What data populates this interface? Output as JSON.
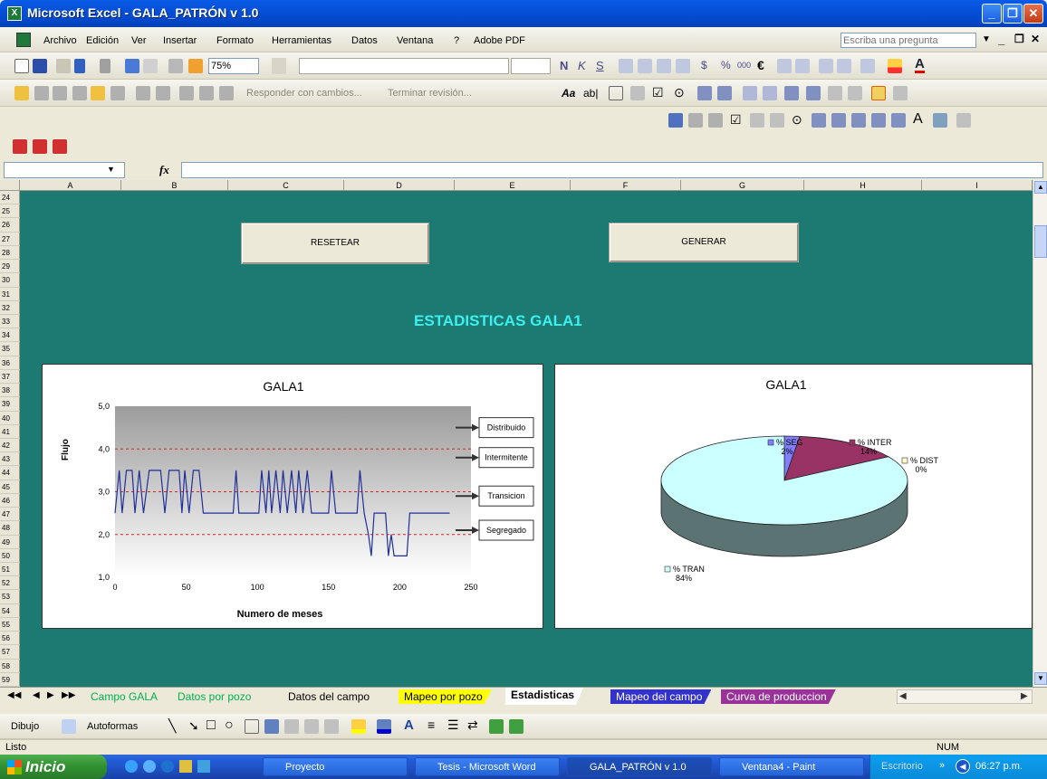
{
  "window": {
    "title": "Microsoft Excel - GALA_PATRÓN v 1.0"
  },
  "menu": {
    "items": [
      "Archivo",
      "Edición",
      "Ver",
      "Insertar",
      "Formato",
      "Herramientas",
      "Datos",
      "Ventana",
      "?",
      "Adobe PDF"
    ],
    "ask_placeholder": "Escriba una pregunta"
  },
  "toolbar": {
    "zoom": "75%",
    "review_reply": "Responder con cambios...",
    "review_end": "Terminar revisión..."
  },
  "formula_bar": {
    "fx": "fx",
    "name_box": "",
    "content": ""
  },
  "columns": [
    "A",
    "B",
    "C",
    "D",
    "E",
    "F",
    "G",
    "H",
    "I"
  ],
  "rows": [
    "24",
    "25",
    "26",
    "27",
    "28",
    "29",
    "30",
    "31",
    "32",
    "33",
    "34",
    "35",
    "36",
    "37",
    "38",
    "39",
    "40",
    "41",
    "42",
    "43",
    "44",
    "45",
    "46",
    "47",
    "48",
    "49",
    "50",
    "51",
    "52",
    "53",
    "54",
    "55",
    "56",
    "57",
    "58",
    "59"
  ],
  "sheet": {
    "reset_label": "RESETEAR",
    "generate_label": "GENERAR",
    "stats_title": "ESTADISTICAS GALA1"
  },
  "chart_data": [
    {
      "type": "line",
      "title": "GALA1",
      "xlabel": "Numero de meses",
      "ylabel": "Flujo",
      "xlim": [
        0,
        250
      ],
      "ylim": [
        1.0,
        5.0
      ],
      "xticks": [
        "0",
        "50",
        "100",
        "150",
        "200",
        "250"
      ],
      "yticks": [
        "1,0",
        "2,0",
        "3,0",
        "4,0",
        "5,0"
      ],
      "series": [
        {
          "values": [
            [
              0,
              2.5
            ],
            [
              3,
              3.5
            ],
            [
              5,
              2.5
            ],
            [
              8,
              3.5
            ],
            [
              12,
              3.5
            ],
            [
              14,
              2.5
            ],
            [
              17,
              3.5
            ],
            [
              20,
              2.5
            ],
            [
              24,
              3.5
            ],
            [
              32,
              3.5
            ],
            [
              35,
              2.5
            ],
            [
              38,
              3.5
            ],
            [
              45,
              3.5
            ],
            [
              47,
              2.5
            ],
            [
              49,
              3.5
            ],
            [
              52,
              2.5
            ],
            [
              55,
              3.5
            ],
            [
              59,
              3.5
            ],
            [
              62,
              2.5
            ],
            [
              83,
              2.5
            ],
            [
              85,
              3.5
            ],
            [
              87,
              2.5
            ],
            [
              101,
              2.5
            ],
            [
              103,
              3.5
            ],
            [
              106,
              2.5
            ],
            [
              108,
              3.5
            ],
            [
              110,
              2.5
            ],
            [
              113,
              3.5
            ],
            [
              116,
              2.5
            ],
            [
              118,
              3.5
            ],
            [
              121,
              2.5
            ],
            [
              124,
              3.5
            ],
            [
              127,
              2.5
            ],
            [
              129,
              3.5
            ],
            [
              132,
              2.5
            ],
            [
              135,
              3.5
            ],
            [
              138,
              2.5
            ],
            [
              150,
              2.5
            ],
            [
              152,
              3.5
            ],
            [
              155,
              2.5
            ],
            [
              170,
              2.5
            ],
            [
              172,
              3.5
            ],
            [
              175,
              2.5
            ],
            [
              178,
              2.0
            ],
            [
              180,
              1.5
            ],
            [
              182,
              2.5
            ],
            [
              190,
              2.5
            ],
            [
              192,
              1.5
            ],
            [
              194,
              2.0
            ],
            [
              196,
              1.5
            ],
            [
              205,
              1.5
            ],
            [
              207,
              2.5
            ],
            [
              235,
              2.5
            ]
          ]
        }
      ],
      "annotations": [
        "Distribuido",
        "Intermitente",
        "Transicion",
        "Segregado"
      ],
      "reference_lines": [
        4.0,
        3.0,
        2.0
      ]
    },
    {
      "type": "pie",
      "title": "GALA1",
      "slices": [
        {
          "label": "% SEG",
          "value": 2,
          "text": "2%",
          "color": "#8080ff"
        },
        {
          "label": "% INTER",
          "value": 14,
          "text": "14%",
          "color": "#993366"
        },
        {
          "label": "% DIST",
          "value": 0,
          "text": "0%",
          "color": "#ffffcc"
        },
        {
          "label": "% TRAN",
          "value": 84,
          "text": "84%",
          "color": "#ccffff"
        }
      ]
    }
  ],
  "tabs": [
    {
      "label": "Campo GALA",
      "color": "#00b050",
      "bg": "#ece9d8"
    },
    {
      "label": "Datos por pozo",
      "color": "#00b050",
      "bg": "#ece9d8"
    },
    {
      "label": "Datos del campo",
      "color": "#000000",
      "bg": "#ece9d8"
    },
    {
      "label": "Mapeo por pozo",
      "color": "#000000",
      "bg": "#ffff00"
    },
    {
      "label": "Estadisticas",
      "color": "#000000",
      "bg": "#ffffff"
    },
    {
      "label": "Mapeo del campo",
      "color": "#ffffff",
      "bg": "#3333cc"
    },
    {
      "label": "Curva de produccion",
      "color": "#ffffff",
      "bg": "#993399"
    }
  ],
  "drawbar": {
    "draw": "Dibujo",
    "autoshapes": "Autoformas"
  },
  "status": {
    "text": "Listo",
    "num": "NUM"
  },
  "taskbar": {
    "start": "Inicio",
    "tasks": [
      "Proyecto",
      "Tesis - Microsoft Word",
      "GALA_PATRÓN v 1.0",
      "Ventana4 - Paint"
    ],
    "desktop": "Escritorio",
    "time": "06:27 p.m."
  }
}
